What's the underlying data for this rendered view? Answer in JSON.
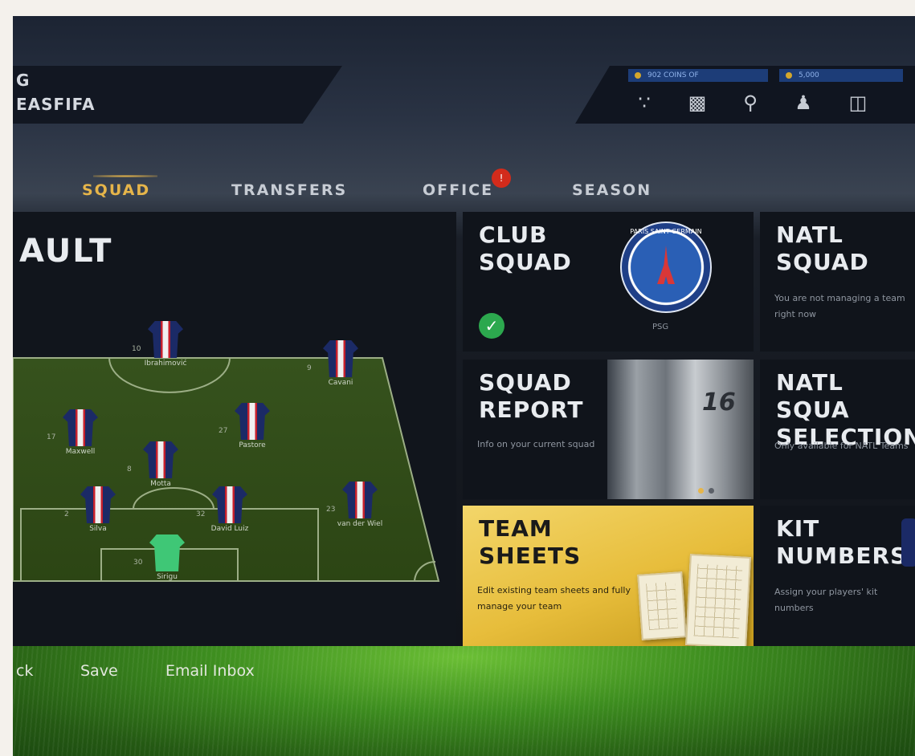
{
  "header": {
    "name_line1": "G",
    "name_line2": "EASFIFA",
    "coins_label": "902 COINS OF",
    "points_label": "5,000",
    "icons": [
      "share-icon",
      "store-icon",
      "trophy-icon",
      "players-icon",
      "cart-icon"
    ]
  },
  "tabs": [
    {
      "label": "SQUAD",
      "active": true
    },
    {
      "label": "TRANSFERS",
      "active": false
    },
    {
      "label": "OFFICE",
      "active": false,
      "badge": "!"
    },
    {
      "label": "SEASON",
      "active": false
    }
  ],
  "formation": {
    "title": "AULT",
    "players": [
      {
        "name": "Ibrahimović",
        "number": "10"
      },
      {
        "name": "Cavani",
        "number": "9"
      },
      {
        "name": "Maxwell",
        "number": "17"
      },
      {
        "name": "Pastore",
        "number": "27"
      },
      {
        "name": "Motta",
        "number": "8"
      },
      {
        "name": "Silva",
        "number": "2"
      },
      {
        "name": "David Luiz",
        "number": "32"
      },
      {
        "name": "van der Wiel",
        "number": "23"
      },
      {
        "name": "Sirigu",
        "number": "30"
      }
    ]
  },
  "cards": {
    "club_squad": {
      "title_l1": "CLUB",
      "title_l2": "SQUAD",
      "club_tag": "PSG",
      "crest_text": "PARIS SAINT-GERMAIN"
    },
    "natl_squad": {
      "title_l1": "NATL",
      "title_l2": "SQUAD",
      "desc": "You are not managing a team right now"
    },
    "squad_report": {
      "title_l1": "SQUAD",
      "title_l2": "REPORT",
      "desc": "Info on your current squad",
      "shirt_number": "16"
    },
    "natl_selection": {
      "title_l1": "NATL SQUA",
      "title_l2": "SELECTION",
      "desc": "Only available for NATL Teams"
    },
    "team_sheets": {
      "title_l1": "TEAM",
      "title_l2": "SHEETS",
      "desc": "Edit existing team sheets and fully manage your team"
    },
    "kit_numbers": {
      "title_l1": "KIT",
      "title_l2": "NUMBERS",
      "desc": "Assign your players' kit numbers"
    }
  },
  "bottom_bar": {
    "back": "ck",
    "save": "Save",
    "email": "Email Inbox"
  }
}
